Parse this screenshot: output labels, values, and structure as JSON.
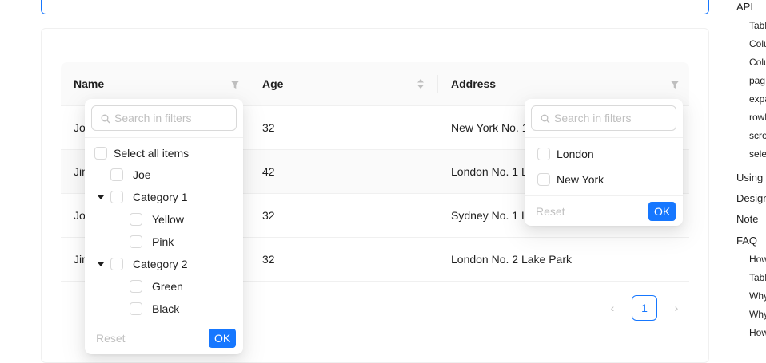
{
  "colors": {
    "primary": "#1677ff",
    "border": "#f0f0f0",
    "muted": "#bfbfbf"
  },
  "code_actions": [
    "codesandbox-icon",
    "codepen-icon",
    "expand-icon",
    "copy-icon",
    "file-icon",
    "code-icon"
  ],
  "table": {
    "columns": [
      {
        "label": "Name",
        "control": "filter-icon"
      },
      {
        "label": "Age",
        "control": "sorter-icon"
      },
      {
        "label": "Address",
        "control": "filter-icon"
      }
    ],
    "rows": [
      {
        "name": "Jo",
        "age": "32",
        "address": "New York No. 1"
      },
      {
        "name": "Jim",
        "age": "42",
        "address": "London No. 1 L"
      },
      {
        "name": "Jo",
        "age": "32",
        "address": "Sydney No. 1 L"
      },
      {
        "name": "Jim",
        "age": "32",
        "address": "London No. 2 Lake Park"
      }
    ]
  },
  "pagination": {
    "prev": "‹",
    "current": "1",
    "next": "›"
  },
  "name_filter": {
    "search_placeholder": "Search in filters",
    "select_all": "Select all items",
    "items": [
      {
        "label": "Joe",
        "level": 0,
        "expandable": false
      },
      {
        "label": "Category 1",
        "level": 0,
        "expandable": true
      },
      {
        "label": "Yellow",
        "level": 1,
        "expandable": false
      },
      {
        "label": "Pink",
        "level": 1,
        "expandable": false
      },
      {
        "label": "Category 2",
        "level": 0,
        "expandable": true
      },
      {
        "label": "Green",
        "level": 1,
        "expandable": false
      },
      {
        "label": "Black",
        "level": 1,
        "expandable": false
      }
    ],
    "reset": "Reset",
    "ok": "OK"
  },
  "address_filter": {
    "search_placeholder": "Search in filters",
    "items": [
      "London",
      "New York"
    ],
    "reset": "Reset",
    "ok": "OK"
  },
  "anchor_nav": {
    "items": [
      {
        "label": "API",
        "level": 0
      },
      {
        "label": "Tabl",
        "level": 1
      },
      {
        "label": "Colu",
        "level": 1
      },
      {
        "label": "Colu",
        "level": 1
      },
      {
        "label": "pag",
        "level": 1
      },
      {
        "label": "expa",
        "level": 1
      },
      {
        "label": "rowl",
        "level": 1
      },
      {
        "label": "scro",
        "level": 1
      },
      {
        "label": "sele",
        "level": 1
      },
      {
        "label": "Using i",
        "level": 0
      },
      {
        "label": "Design",
        "level": 0
      },
      {
        "label": "Note",
        "level": 0
      },
      {
        "label": "FAQ",
        "level": 0
      },
      {
        "label": "How",
        "level": 1
      },
      {
        "label": "Tabl",
        "level": 1
      },
      {
        "label": "Why",
        "level": 1
      },
      {
        "label": "Why",
        "level": 1
      },
      {
        "label": "How",
        "level": 1
      }
    ]
  }
}
